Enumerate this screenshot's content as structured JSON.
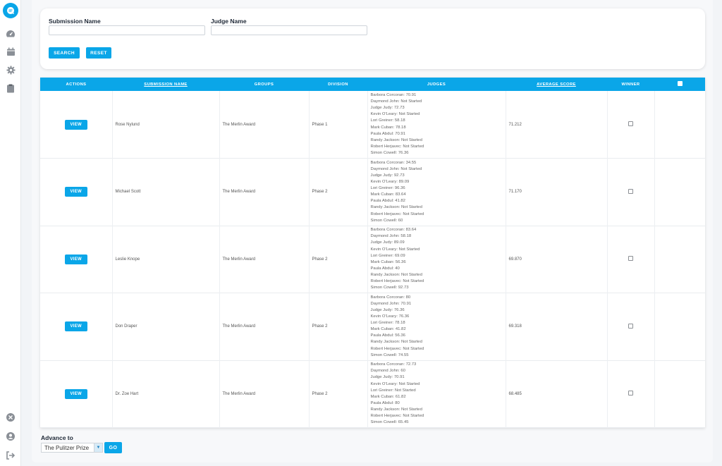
{
  "sidebar": {
    "icons": [
      "chat-logo-icon",
      "dashboard-gauge-icon",
      "calendar-icon",
      "gear-icon",
      "clipboard-icon",
      "close-circle-icon",
      "user-icon",
      "logout-icon"
    ]
  },
  "filters": {
    "submission_label": "Submission Name",
    "submission_value": "",
    "judge_label": "Judge Name",
    "judge_value": "",
    "search_label": "SEARCH",
    "reset_label": "RESET"
  },
  "table": {
    "headers": {
      "actions": "ACTIONS",
      "submission_name": "SUBMISSION NAME",
      "groups": "GROUPS",
      "division": "DIVISION",
      "judges": "JUDGES",
      "average_score": "AVERAGE SCORE",
      "winner": "WINNER"
    },
    "view_label": "VIEW",
    "rows": [
      {
        "name": "Rose Nylund",
        "group": "The Merlin Award",
        "division": "Phase 1",
        "judges": [
          "Barbora Corcoran: 70.91",
          "Daymond John: Not Started",
          "Judge Judy: 72.73",
          "Kevin O'Leary: Not Started",
          "Lori Greiner: 58.18",
          "Mark Cuban: 78.18",
          "Paula Abdul: 70.91",
          "Randy Jackson: Not Started",
          "Robert Herjavec: Not Started",
          "Simon Cowell: 76.36"
        ],
        "score": "71.212",
        "winner": false
      },
      {
        "name": "Michael Scott",
        "group": "The Merlin Award",
        "division": "Phase 2",
        "judges": [
          "Barbora Corcoran: 34.55",
          "Daymond John: Not Started",
          "Judge Judy: 92.73",
          "Kevin O'Leary: 89.09",
          "Lori Greiner: 96.36",
          "Mark Cuban: 83.64",
          "Paula Abdul: 41.82",
          "Randy Jackson: Not Started",
          "Robert Herjavec: Not Started",
          "Simon Cowell: 60"
        ],
        "score": "71.170",
        "winner": false
      },
      {
        "name": "Leslie Knope",
        "group": "The Merlin Award",
        "division": "Phase 2",
        "judges": [
          "Barbora Corcoran: 83.64",
          "Daymond John: 58.18",
          "Judge Judy: 89.09",
          "Kevin O'Leary: Not Started",
          "Lori Greiner: 69.09",
          "Mark Cuban: 56.36",
          "Paula Abdul: 40",
          "Randy Jackson: Not Started",
          "Robert Herjavec: Not Started",
          "Simon Cowell: 92.73"
        ],
        "score": "69.870",
        "winner": false
      },
      {
        "name": "Don Draper",
        "group": "The Merlin Award",
        "division": "Phase 2",
        "judges": [
          "Barbora Corcoran: 80",
          "Daymond John: 70.91",
          "Judge Judy: 76.36",
          "Kevin O'Leary: 76.36",
          "Lori Greiner: 78.18",
          "Mark Cuban: 41.82",
          "Paula Abdul: 56.36",
          "Randy Jackson: Not Started",
          "Robert Herjavec: Not Started",
          "Simon Cowell: 74.55"
        ],
        "score": "69.318",
        "winner": false
      },
      {
        "name": "Dr. Zoe Hart",
        "group": "The Merlin Award",
        "division": "Phase 2",
        "judges": [
          "Barbora Corcoran: 72.73",
          "Daymond John: 60",
          "Judge Judy: 70.91",
          "Kevin O'Leary: Not Started",
          "Lori Greiner: Not Started",
          "Mark Cuban: 61.82",
          "Paula Abdul: 80",
          "Randy Jackson: Not Started",
          "Robert Herjavec: Not Started",
          "Simon Cowell: 65.45"
        ],
        "score": "68.485",
        "winner": false
      }
    ]
  },
  "advance": {
    "label": "Advance to",
    "selected": "The Pulitzer Prize",
    "go_label": "GO"
  },
  "colors": {
    "accent": "#0aa6e8",
    "sidebar_icon": "#8a8f96"
  }
}
